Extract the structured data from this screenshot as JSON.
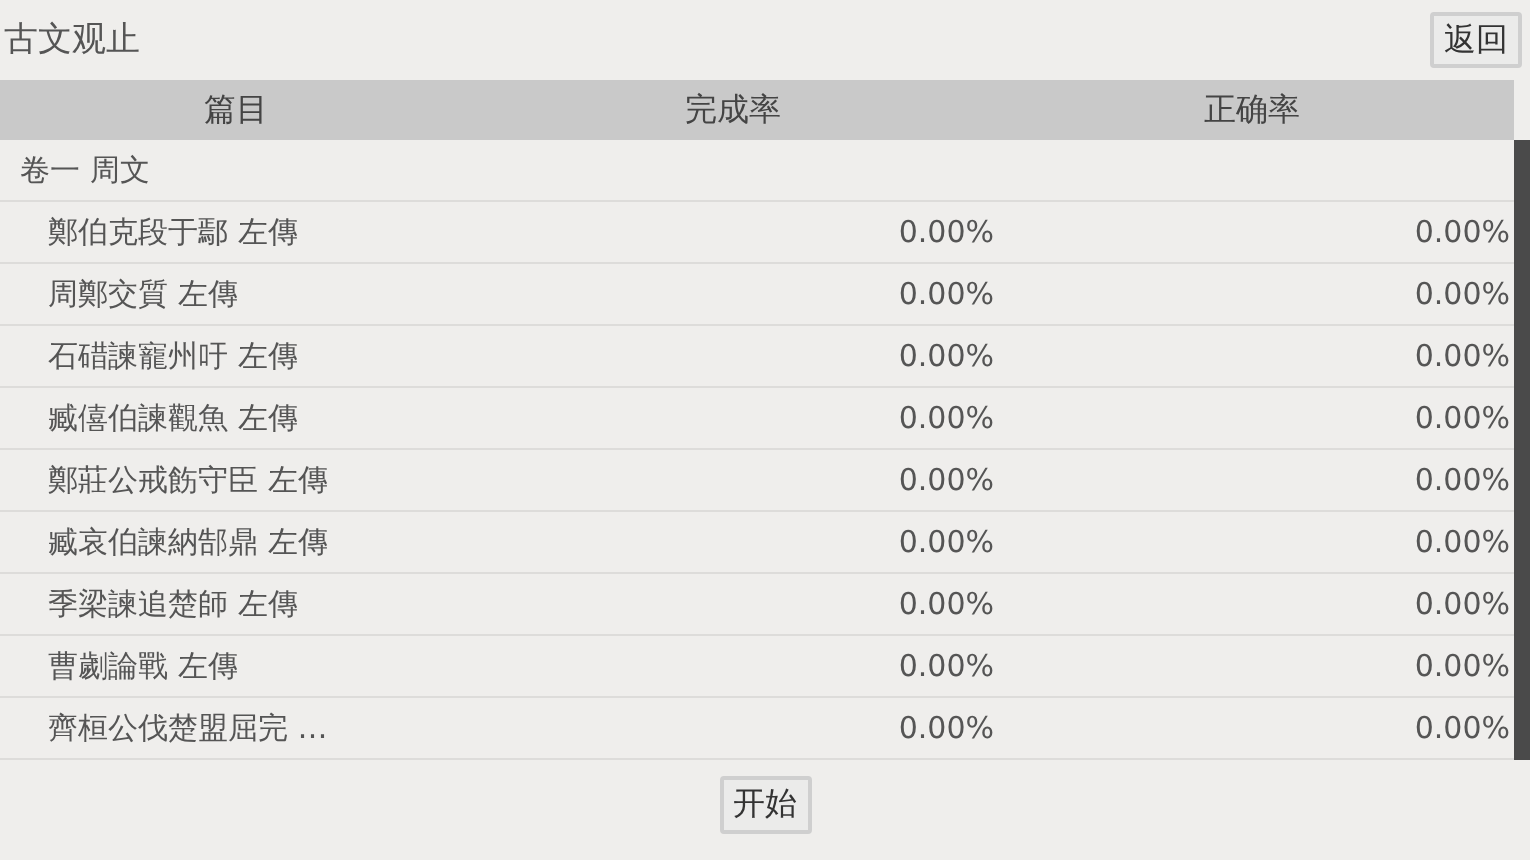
{
  "title": "古文观止",
  "back_button": "返回",
  "table": {
    "columns": [
      "篇目",
      "完成率",
      "正确率"
    ],
    "groups": [
      {
        "label": "卷一 周文",
        "rows": [
          {
            "title": "鄭伯克段于鄢 左傳",
            "completion": "0.00%",
            "accuracy": "0.00%"
          },
          {
            "title": "周鄭交質 左傳",
            "completion": "0.00%",
            "accuracy": "0.00%"
          },
          {
            "title": "石碏諫寵州吁 左傳",
            "completion": "0.00%",
            "accuracy": "0.00%"
          },
          {
            "title": "臧僖伯諫觀魚 左傳",
            "completion": "0.00%",
            "accuracy": "0.00%"
          },
          {
            "title": "鄭莊公戒飭守臣 左傳",
            "completion": "0.00%",
            "accuracy": "0.00%"
          },
          {
            "title": "臧哀伯諫納郜鼎 左傳",
            "completion": "0.00%",
            "accuracy": "0.00%"
          },
          {
            "title": "季梁諫追楚師 左傳",
            "completion": "0.00%",
            "accuracy": "0.00%"
          },
          {
            "title": "曹劌論戰 左傳",
            "completion": "0.00%",
            "accuracy": "0.00%"
          },
          {
            "title": "齊桓公伐楚盟屈完 …",
            "completion": "0.00%",
            "accuracy": "0.00%"
          }
        ]
      }
    ]
  },
  "start_button": "开始"
}
